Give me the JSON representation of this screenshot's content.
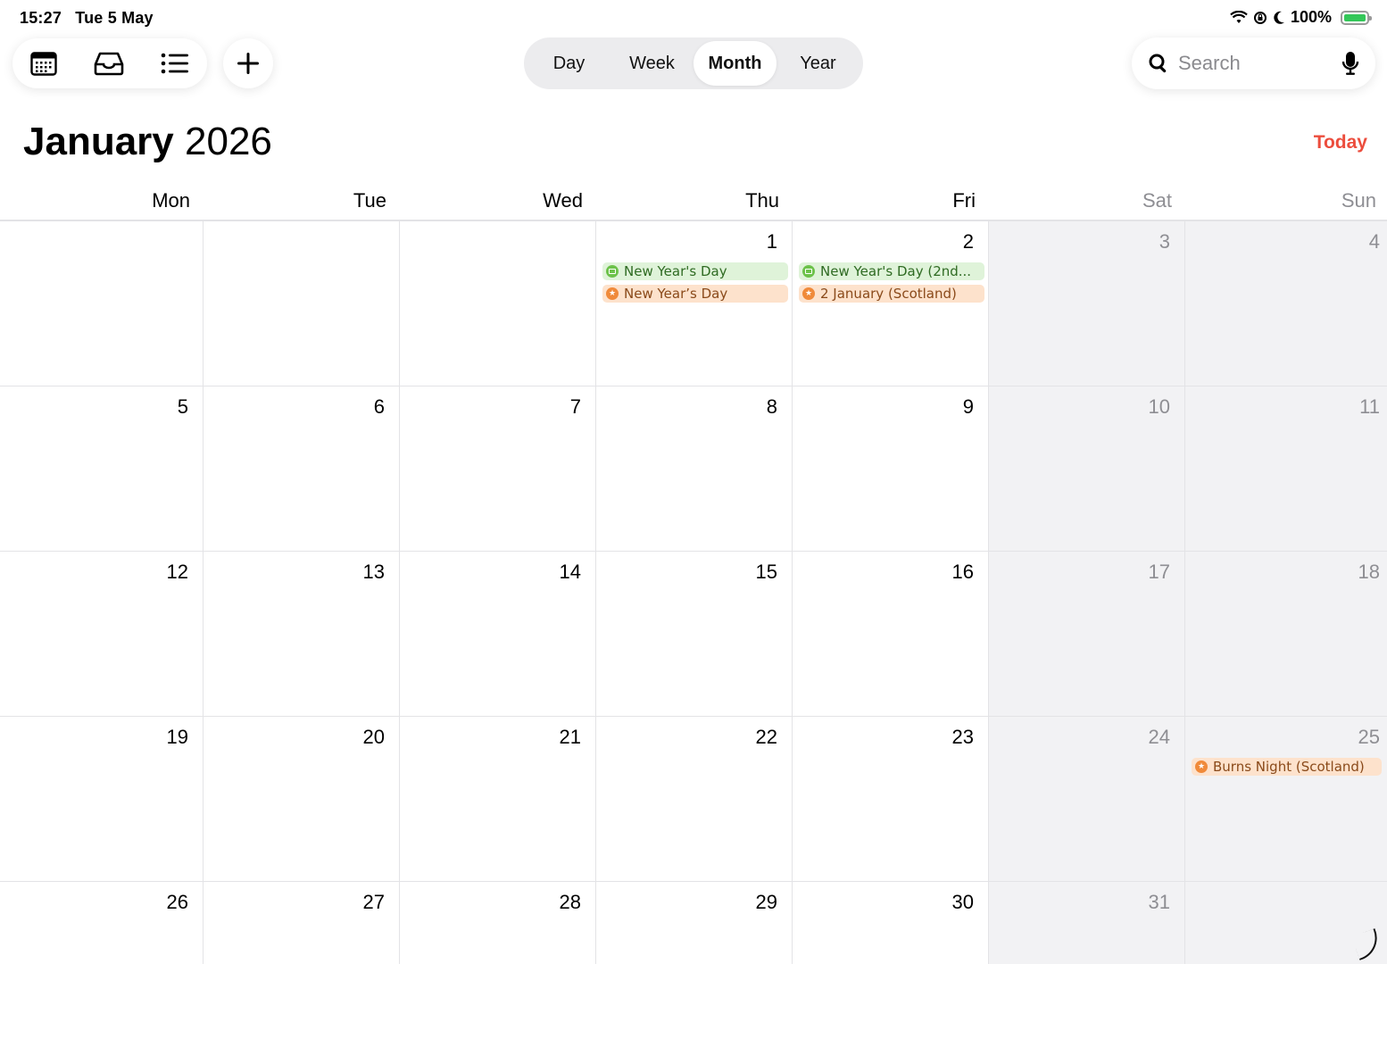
{
  "status_bar": {
    "time": "15:27",
    "date": "Tue 5 May",
    "battery": "100%"
  },
  "toolbar": {
    "calendars_icon": "calendar-grid-icon",
    "inbox_icon": "inbox-tray-icon",
    "list_icon": "list-icon",
    "add_icon": "plus-icon"
  },
  "view_modes": [
    "Day",
    "Week",
    "Month",
    "Year"
  ],
  "active_view": "Month",
  "search": {
    "placeholder": "Search"
  },
  "header": {
    "month": "January",
    "year": "2026",
    "today_label": "Today"
  },
  "weekdays": [
    "Mon",
    "Tue",
    "Wed",
    "Thu",
    "Fri",
    "Sat",
    "Sun"
  ],
  "colors": {
    "accent": "#ec4d3d",
    "holiday_green": "#6cc24a",
    "holiday_orange": "#f08a3a"
  },
  "weeks": [
    [
      "",
      "",
      "",
      "1",
      "2",
      "3",
      "4"
    ],
    [
      "5",
      "6",
      "7",
      "8",
      "9",
      "10",
      "11"
    ],
    [
      "12",
      "13",
      "14",
      "15",
      "16",
      "17",
      "18"
    ],
    [
      "19",
      "20",
      "21",
      "22",
      "23",
      "24",
      "25"
    ],
    [
      "26",
      "27",
      "28",
      "29",
      "30",
      "31",
      ""
    ]
  ],
  "events": [
    {
      "week": 0,
      "day": 3,
      "slot": 0,
      "color": "green",
      "title": "New Year's Day"
    },
    {
      "week": 0,
      "day": 3,
      "slot": 1,
      "color": "orange",
      "title": "New Year’s Day"
    },
    {
      "week": 0,
      "day": 4,
      "slot": 0,
      "color": "green",
      "title": "New Year's Day (2nd..."
    },
    {
      "week": 0,
      "day": 4,
      "slot": 1,
      "color": "orange",
      "title": "2 January (Scotland)"
    },
    {
      "week": 3,
      "day": 6,
      "slot": 0,
      "color": "orange",
      "title": "Burns Night (Scotland)"
    }
  ]
}
